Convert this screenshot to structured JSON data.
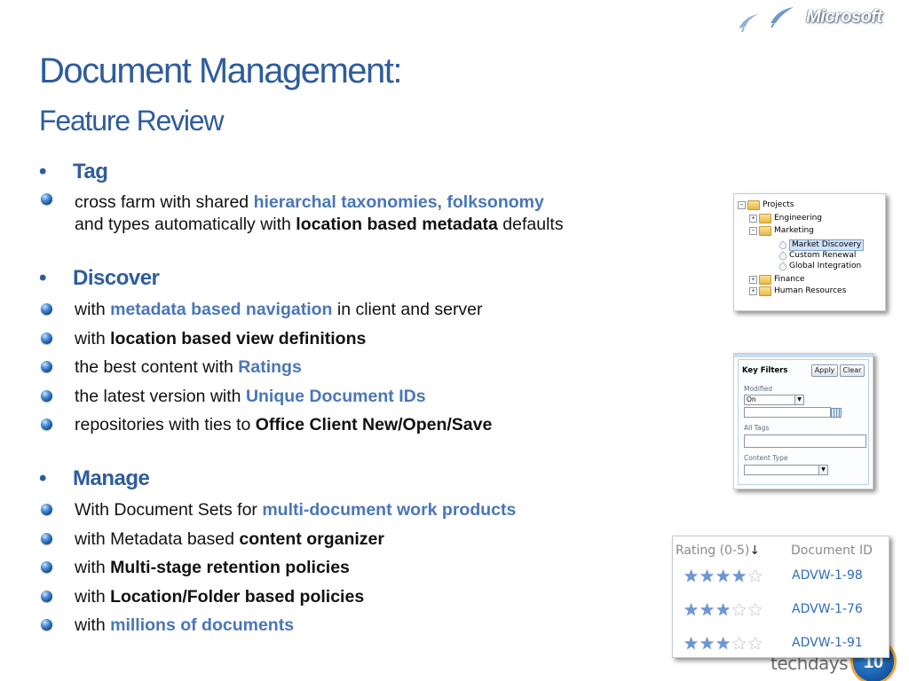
{
  "brand": {
    "name": "Microsoft"
  },
  "slide": {
    "title": "Document Management:",
    "subtitle": "Feature Review"
  },
  "sections": [
    {
      "heading": "Tag",
      "items": [
        {
          "runs": [
            {
              "text": "cross farm with shared ",
              "style": "normal"
            },
            {
              "text": "hierarchal taxonomies, folksonomy",
              "style": "highlight"
            }
          ],
          "line2": [
            {
              "text": "and types automatically with ",
              "style": "normal"
            },
            {
              "text": "location based metadata",
              "style": "bold"
            },
            {
              "text": " defaults",
              "style": "normal"
            }
          ]
        }
      ]
    },
    {
      "heading": "Discover",
      "items": [
        {
          "runs": [
            {
              "text": "with ",
              "style": "normal"
            },
            {
              "text": "metadata based navigation",
              "style": "highlight"
            },
            {
              "text": " in client and server",
              "style": "normal"
            }
          ]
        },
        {
          "runs": [
            {
              "text": "with ",
              "style": "normal"
            },
            {
              "text": "location based view definitions",
              "style": "bold"
            }
          ]
        },
        {
          "runs": [
            {
              "text": "the best content with ",
              "style": "normal"
            },
            {
              "text": "Ratings",
              "style": "highlight"
            }
          ]
        },
        {
          "runs": [
            {
              "text": "the latest version with ",
              "style": "normal"
            },
            {
              "text": "Unique Document IDs",
              "style": "highlight"
            }
          ]
        },
        {
          "runs": [
            {
              "text": "repositories with ties to ",
              "style": "normal"
            },
            {
              "text": "Office Client New/Open/Save",
              "style": "bold"
            }
          ]
        }
      ]
    },
    {
      "heading": "Manage",
      "items": [
        {
          "runs": [
            {
              "text": "With Document Sets for ",
              "style": "normal"
            },
            {
              "text": "multi-document work products",
              "style": "highlight"
            }
          ]
        },
        {
          "runs": [
            {
              "text": "with Metadata based ",
              "style": "normal"
            },
            {
              "text": "content organizer",
              "style": "bold"
            }
          ]
        },
        {
          "runs": [
            {
              "text": "with ",
              "style": "normal"
            },
            {
              "text": "Multi-stage retention policies",
              "style": "bold"
            }
          ]
        },
        {
          "runs": [
            {
              "text": "with ",
              "style": "normal"
            },
            {
              "text": "Location/Folder based policies",
              "style": "bold"
            }
          ]
        },
        {
          "runs": [
            {
              "text": "with ",
              "style": "normal"
            },
            {
              "text": "millions of documents",
              "style": "highlight"
            }
          ]
        }
      ]
    }
  ],
  "tree_panel": {
    "nodes": [
      {
        "label": "Projects",
        "toggle": "−",
        "kind": "folder"
      },
      {
        "label": "Engineering",
        "toggle": "+",
        "kind": "folder"
      },
      {
        "label": "Marketing",
        "toggle": "−",
        "kind": "folder"
      },
      {
        "label": "Market Discovery",
        "toggle": "",
        "kind": "term",
        "selected": true
      },
      {
        "label": "Custom Renewal",
        "toggle": "",
        "kind": "term"
      },
      {
        "label": "Global Integration",
        "toggle": "",
        "kind": "term"
      },
      {
        "label": "Finance",
        "toggle": "+",
        "kind": "folder"
      },
      {
        "label": "Human Resources",
        "toggle": "+",
        "kind": "folder"
      }
    ]
  },
  "filters_panel": {
    "title": "Key Filters",
    "apply": "Apply",
    "clear": "Clear",
    "modified_label": "Modified",
    "modified_value": "On",
    "all_tags_label": "All Tags",
    "content_type_label": "Content Type"
  },
  "ratings_panel": {
    "rating_header": "Rating (0-5)",
    "sort_icon": "sort-down-arrow-icon",
    "id_header": "Document ID",
    "rows": [
      {
        "rating": 4,
        "max": 5,
        "id": "ADVW-1-98"
      },
      {
        "rating": 3,
        "max": 5,
        "id": "ADVW-1-76"
      },
      {
        "rating": 3,
        "max": 5,
        "id": "ADVW-1-91"
      }
    ]
  },
  "footer_logo": {
    "word": "techdays",
    "number": "10"
  },
  "colors": {
    "title": "#2f5c9c",
    "highlight": "#4a76b8",
    "body_text": "#111111",
    "link_id": "#2f6db8",
    "star_full": "#6d96d6"
  }
}
